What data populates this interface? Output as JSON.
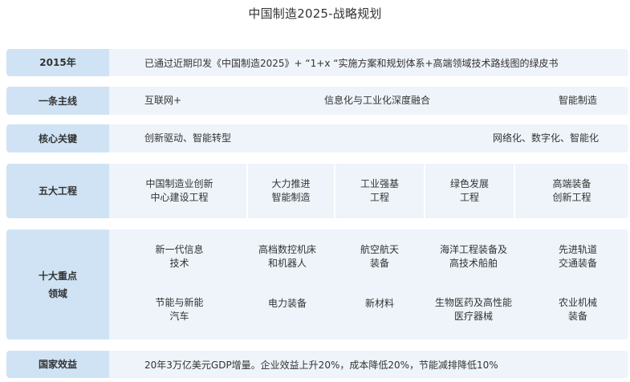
{
  "title": "中国制造2025-战略规划",
  "rows": {
    "r2015": {
      "label": "2015年",
      "text": "已通过近期印发《中国制造2025》+ “1+x “实施方案和规划体系+高端领域技术路线图的绿皮书"
    },
    "mainline": {
      "label": "一条主线",
      "items": [
        "互联网+",
        "信息化与工业化深度融合",
        "智能制造"
      ]
    },
    "key": {
      "label": "核心关键",
      "items": [
        "创新驱动、智能转型",
        "网络化、数字化、智能化"
      ]
    },
    "projects": {
      "label": "五大工程",
      "items": [
        "中国制造业创新\n中心建设工程",
        "大力推进\n智能制造",
        "工业强基\n工程",
        "绿色发展\n工程",
        "高端装备\n创新工程"
      ]
    },
    "fields": {
      "label": "十大重点\n领域",
      "items": [
        "新一代信息\n技术",
        "高档数控机床\n和机器人",
        "航空航天\n装备",
        "海洋工程装备及\n高技术船舶",
        "先进轨道\n交通装备",
        "节能与新能\n汽车",
        "电力装备",
        "新材料",
        "生物医药及高性能\n医疗器械",
        "农业机械\n装备"
      ]
    },
    "benefit": {
      "label": "国家效益",
      "text": "20年3万亿美元GDP增量。企业效益上升20%，成本降低20%，节能减排降低10%"
    }
  },
  "colors": {
    "label_bg": "#cfe3f4",
    "row_bg": "#eef4fa",
    "separator": "#ffffff"
  }
}
